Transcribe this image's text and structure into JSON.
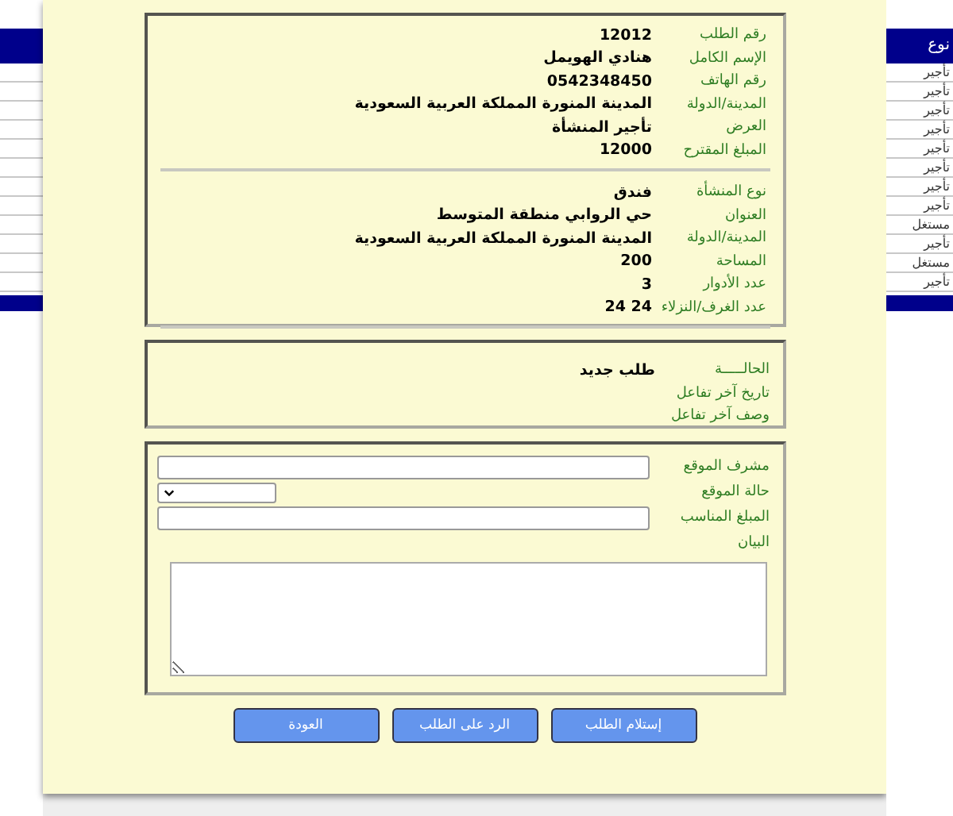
{
  "background_table": {
    "header": "نوع",
    "rows": [
      "تأجير",
      "تأجير",
      "تأجير",
      "تأجير",
      "تأجير",
      "تأجير",
      "تأجير",
      "تأجير",
      "مستغل",
      "تأجير",
      "مستغل",
      "تأجير"
    ]
  },
  "request": {
    "fields": [
      {
        "label": "رقم الطلب",
        "value": "12012"
      },
      {
        "label": "الإسم الكامل",
        "value": "هنادي الهويمل"
      },
      {
        "label": "رقم الهاتف",
        "value": "0542348450"
      },
      {
        "label": "المدينة/الدولة",
        "value": "المدينة المنورة المملكة العربية السعودية"
      },
      {
        "label": "العرض",
        "value": "تأجير المنشأة"
      },
      {
        "label": "المبلغ المقترح",
        "value": "12000"
      }
    ]
  },
  "facility": {
    "fields": [
      {
        "label": "نوع المنشأة",
        "value": "فندق"
      },
      {
        "label": "العنوان",
        "value": "حي الروابي منطقة المتوسط"
      },
      {
        "label": "المدينة/الدولة",
        "value": "المدينة المنورة المملكة العربية السعودية"
      },
      {
        "label": "المساحة",
        "value": "200"
      },
      {
        "label": "عدد الأدوار",
        "value": "3"
      },
      {
        "label": "عدد الغرف/النزلاء",
        "value": "24 24"
      }
    ]
  },
  "status": {
    "fields": [
      {
        "label": "الحالـــــة",
        "value": "طلب جديد"
      },
      {
        "label": "تاريخ آخر تفاعل"
      },
      {
        "label": "وصف آخر تفاعل"
      }
    ]
  },
  "form": {
    "fields": [
      {
        "label": "مشرف الموقع",
        "kind": "text"
      },
      {
        "label": "حالة الموقع",
        "kind": "select"
      },
      {
        "label": "المبلغ المناسب",
        "kind": "text"
      },
      {
        "label": "البيان",
        "kind": "textarea"
      }
    ]
  },
  "buttons": [
    "إستلام الطلب",
    "الرد على الطلب",
    "العودة"
  ]
}
